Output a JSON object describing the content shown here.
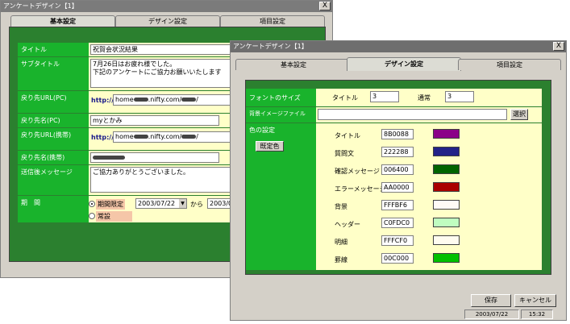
{
  "back_window": {
    "title": "アンケートデザイン【1】",
    "close": "X",
    "tabs": [
      "基本設定",
      "デザイン設定",
      "項目設定"
    ],
    "rows": {
      "title_label": "タイトル",
      "title_value": "祝賀会状況結果",
      "subtitle_label": "サブタイトル",
      "subtitle_line1": "7月26日はお疲れ様でした。",
      "subtitle_line2": "下記のアンケートにご協力お願いいたします",
      "return_url_pc_label": "戻り先URL(PC)",
      "url_prefix": "http://",
      "return_url_pc_a": "home",
      "return_url_pc_b": ".nifty.com/",
      "return_url_pc_c": "/",
      "return_name_pc_label": "戻り先名(PC)",
      "return_name_pc_value": "myとかみ",
      "return_url_mobile_label": "戻り先URL(携帯)",
      "return_url_mobile_a": "home",
      "return_url_mobile_b": ".nifty.com/",
      "return_url_mobile_c": "/",
      "return_name_mobile_label": "戻り先名(携帯)",
      "after_msg_label": "送信後メッセージ",
      "after_msg_value": "ご協力ありがとうございました。",
      "period_label": "期　間",
      "period_limited": "期間限定",
      "period_start": "2003/07/22",
      "period_kara": "から",
      "period_end": "2003/08",
      "period_always": "常設"
    }
  },
  "front_window": {
    "title": "アンケートデザイン【1】",
    "close": "X",
    "tabs": [
      "基本設定",
      "デザイン設定",
      "項目設定"
    ],
    "font_size_label": "フォントのサイズ",
    "title_label": "タイトル",
    "title_size": "3",
    "normal_label": "通常",
    "normal_size": "3",
    "bg_image_label": "背景イメージファイル",
    "bg_image_value": "",
    "select_button": "選択",
    "color_label": "色の設定",
    "default_color_button": "既定色",
    "colors": [
      {
        "name": "タイトル",
        "hex": "8B0088",
        "color": "#8b0088"
      },
      {
        "name": "質問文",
        "hex": "222288",
        "color": "#222288"
      },
      {
        "name": "確認メッセージ",
        "hex": "006400",
        "color": "#006400"
      },
      {
        "name": "エラーメッセージ",
        "hex": "AA0000",
        "color": "#aa0000"
      },
      {
        "name": "背景",
        "hex": "FFFBF6",
        "color": "#fffbf6"
      },
      {
        "name": "ヘッダー",
        "hex": "C0FDC0",
        "color": "#c0fdc0"
      },
      {
        "name": "明細",
        "hex": "FFFCF0",
        "color": "#fffcf0"
      },
      {
        "name": "罫線",
        "hex": "00C000",
        "color": "#00c000"
      }
    ],
    "save_button": "保存",
    "cancel_button": "キャンセル",
    "status_date": "2003/07/22",
    "status_time": "15:32"
  }
}
